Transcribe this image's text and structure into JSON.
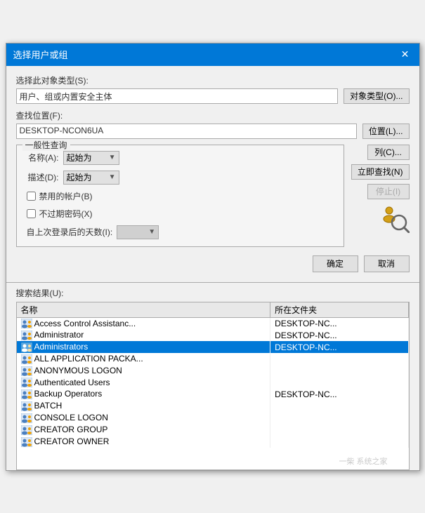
{
  "dialog": {
    "title": "选择用户或组",
    "close_label": "✕"
  },
  "object_type": {
    "label": "选择此对象类型(S):",
    "value": "用户、组或内置安全主体",
    "button": "对象类型(O)..."
  },
  "location": {
    "label": "查找位置(F):",
    "value": "DESKTOP-NCON6UA",
    "button": "位置(L)..."
  },
  "general_query": {
    "title": "一般性查询",
    "name_label": "名称(A):",
    "name_value": "起始为",
    "desc_label": "描述(D):",
    "desc_value": "起始为",
    "disabled_accounts": "禁用的帐户(B)",
    "no_expire_pwd": "不过期密码(X)",
    "days_label": "自上次登录后的天数(I):",
    "col_button": "列(C)...",
    "search_button": "立即查找(N)",
    "stop_button": "停止(I)"
  },
  "results": {
    "label": "搜索结果(U):",
    "col_name": "名称",
    "col_folder": "所在文件夹",
    "rows": [
      {
        "id": 1,
        "name": "Access Control Assistanc...",
        "folder": "DESKTOP-NC...",
        "selected": false
      },
      {
        "id": 2,
        "name": "Administrator",
        "folder": "DESKTOP-NC...",
        "selected": false
      },
      {
        "id": 3,
        "name": "Administrators",
        "folder": "DESKTOP-NC...",
        "selected": true
      },
      {
        "id": 4,
        "name": "ALL APPLICATION PACKA...",
        "folder": "",
        "selected": false
      },
      {
        "id": 5,
        "name": "ANONYMOUS LOGON",
        "folder": "",
        "selected": false
      },
      {
        "id": 6,
        "name": "Authenticated Users",
        "folder": "",
        "selected": false
      },
      {
        "id": 7,
        "name": "Backup Operators",
        "folder": "DESKTOP-NC...",
        "selected": false
      },
      {
        "id": 8,
        "name": "BATCH",
        "folder": "",
        "selected": false
      },
      {
        "id": 9,
        "name": "CONSOLE LOGON",
        "folder": "",
        "selected": false
      },
      {
        "id": 10,
        "name": "CREATOR GROUP",
        "folder": "",
        "selected": false
      },
      {
        "id": 11,
        "name": "CREATOR OWNER",
        "folder": "",
        "selected": false
      }
    ]
  },
  "buttons": {
    "ok": "确定",
    "cancel": "取消"
  }
}
